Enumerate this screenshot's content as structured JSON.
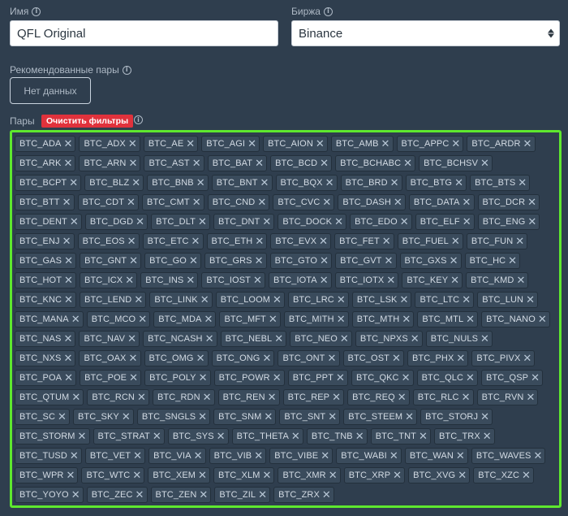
{
  "name_field": {
    "label": "Имя",
    "value": "QFL Original"
  },
  "exchange_field": {
    "label": "Биржа",
    "value": "Binance"
  },
  "recommended": {
    "label": "Рекомендованные пары",
    "empty_text": "Нет данных"
  },
  "pairs": {
    "label": "Пары",
    "clear_button": "Очистить фильтры",
    "items": [
      "BTC_ADA",
      "BTC_ADX",
      "BTC_AE",
      "BTC_AGI",
      "BTC_AION",
      "BTC_AMB",
      "BTC_APPC",
      "BTC_ARDR",
      "BTC_ARK",
      "BTC_ARN",
      "BTC_AST",
      "BTC_BAT",
      "BTC_BCD",
      "BTC_BCHABC",
      "BTC_BCHSV",
      "BTC_BCPT",
      "BTC_BLZ",
      "BTC_BNB",
      "BTC_BNT",
      "BTC_BQX",
      "BTC_BRD",
      "BTC_BTG",
      "BTC_BTS",
      "BTC_BTT",
      "BTC_CDT",
      "BTC_CMT",
      "BTC_CND",
      "BTC_CVC",
      "BTC_DASH",
      "BTC_DATA",
      "BTC_DCR",
      "BTC_DENT",
      "BTC_DGD",
      "BTC_DLT",
      "BTC_DNT",
      "BTC_DOCK",
      "BTC_EDO",
      "BTC_ELF",
      "BTC_ENG",
      "BTC_ENJ",
      "BTC_EOS",
      "BTC_ETC",
      "BTC_ETH",
      "BTC_EVX",
      "BTC_FET",
      "BTC_FUEL",
      "BTC_FUN",
      "BTC_GAS",
      "BTC_GNT",
      "BTC_GO",
      "BTC_GRS",
      "BTC_GTO",
      "BTC_GVT",
      "BTC_GXS",
      "BTC_HC",
      "BTC_HOT",
      "BTC_ICX",
      "BTC_INS",
      "BTC_IOST",
      "BTC_IOTA",
      "BTC_IOTX",
      "BTC_KEY",
      "BTC_KMD",
      "BTC_KNC",
      "BTC_LEND",
      "BTC_LINK",
      "BTC_LOOM",
      "BTC_LRC",
      "BTC_LSK",
      "BTC_LTC",
      "BTC_LUN",
      "BTC_MANA",
      "BTC_MCO",
      "BTC_MDA",
      "BTC_MFT",
      "BTC_MITH",
      "BTC_MTH",
      "BTC_MTL",
      "BTC_NANO",
      "BTC_NAS",
      "BTC_NAV",
      "BTC_NCASH",
      "BTC_NEBL",
      "BTC_NEO",
      "BTC_NPXS",
      "BTC_NULS",
      "BTC_NXS",
      "BTC_OAX",
      "BTC_OMG",
      "BTC_ONG",
      "BTC_ONT",
      "BTC_OST",
      "BTC_PHX",
      "BTC_PIVX",
      "BTC_POA",
      "BTC_POE",
      "BTC_POLY",
      "BTC_POWR",
      "BTC_PPT",
      "BTC_QKC",
      "BTC_QLC",
      "BTC_QSP",
      "BTC_QTUM",
      "BTC_RCN",
      "BTC_RDN",
      "BTC_REN",
      "BTC_REP",
      "BTC_REQ",
      "BTC_RLC",
      "BTC_RVN",
      "BTC_SC",
      "BTC_SKY",
      "BTC_SNGLS",
      "BTC_SNM",
      "BTC_SNT",
      "BTC_STEEM",
      "BTC_STORJ",
      "BTC_STORM",
      "BTC_STRAT",
      "BTC_SYS",
      "BTC_THETA",
      "BTC_TNB",
      "BTC_TNT",
      "BTC_TRX",
      "BTC_TUSD",
      "BTC_VET",
      "BTC_VIA",
      "BTC_VIB",
      "BTC_VIBE",
      "BTC_WABI",
      "BTC_WAN",
      "BTC_WAVES",
      "BTC_WPR",
      "BTC_WTC",
      "BTC_XEM",
      "BTC_XLM",
      "BTC_XMR",
      "BTC_XRP",
      "BTC_XVG",
      "BTC_XZC",
      "BTC_YOYO",
      "BTC_ZEC",
      "BTC_ZEN",
      "BTC_ZIL",
      "BTC_ZRX"
    ]
  },
  "icons": {
    "info": "info-icon",
    "remove": "close-icon",
    "select": "chevron-updown-icon"
  },
  "colors": {
    "background": "#2f3e4e",
    "highlight_border": "#5ee82e",
    "clear_button": "#e0323c"
  }
}
